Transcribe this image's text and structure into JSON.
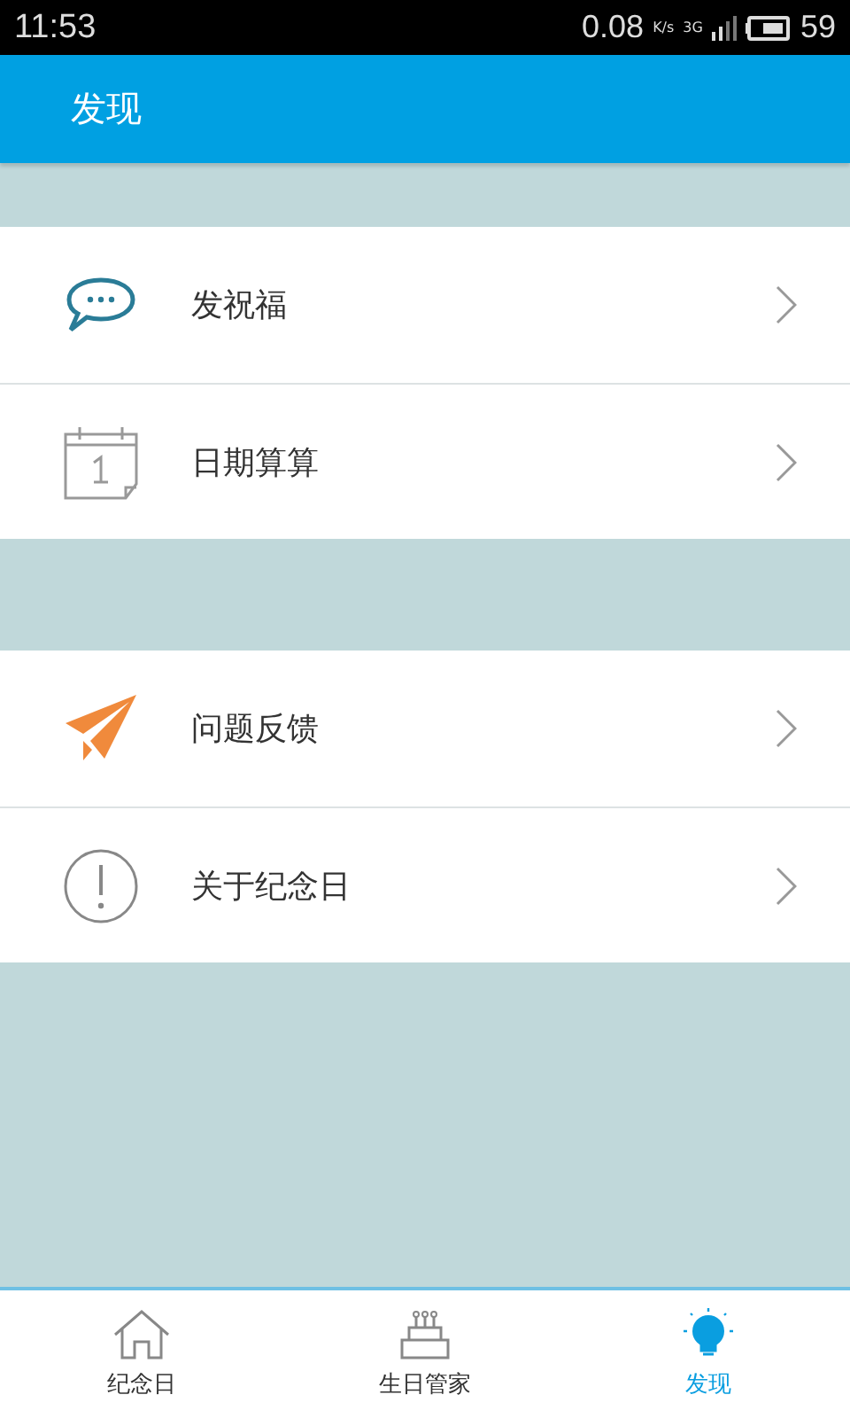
{
  "status_bar": {
    "time": "11:53",
    "speed": "0.08",
    "speed_unit": "K/s",
    "network": "3G",
    "battery": "59"
  },
  "header": {
    "title": "发现"
  },
  "groups": [
    {
      "items": [
        {
          "kind": "chat",
          "label": "发祝福"
        },
        {
          "kind": "calendar",
          "label": "日期算算"
        }
      ]
    },
    {
      "items": [
        {
          "kind": "plane",
          "label": "问题反馈"
        },
        {
          "kind": "info",
          "label": "关于纪念日"
        }
      ]
    }
  ],
  "tabs": [
    {
      "kind": "home",
      "label": "纪念日",
      "selected": false
    },
    {
      "kind": "cake",
      "label": "生日管家",
      "selected": false
    },
    {
      "kind": "bulb",
      "label": "发现",
      "selected": true
    }
  ]
}
